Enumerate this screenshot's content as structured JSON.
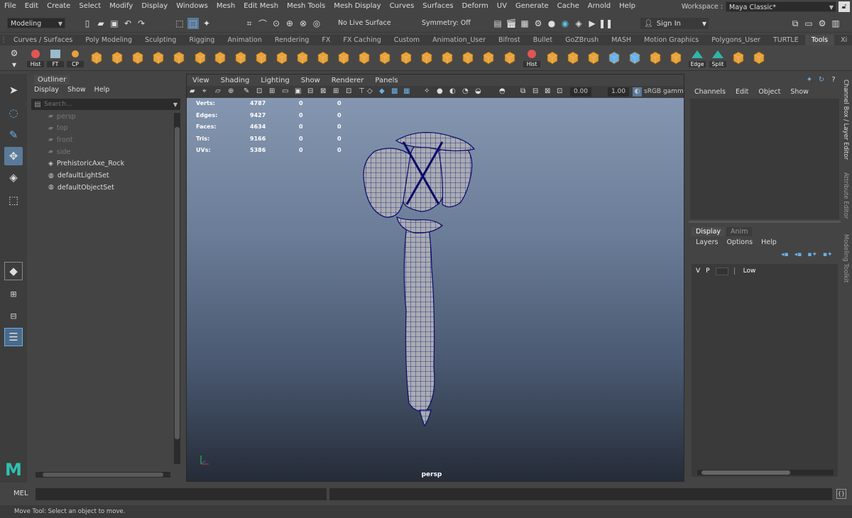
{
  "menus": [
    "File",
    "Edit",
    "Create",
    "Select",
    "Modify",
    "Display",
    "Windows",
    "Mesh",
    "Edit Mesh",
    "Mesh Tools",
    "Mesh Display",
    "Curves",
    "Surfaces",
    "Deform",
    "UV",
    "Generate",
    "Cache",
    "Arnold",
    "Help"
  ],
  "workspace": {
    "label": "Workspace :",
    "value": "Maya Classic*"
  },
  "toolbar": {
    "mode": "Modeling",
    "live_surface": "No Live Surface",
    "symmetry": "Symmetry: Off",
    "sign_in": "Sign In"
  },
  "shelf_tabs": [
    "Curves / Surfaces",
    "Poly Modeling",
    "Sculpting",
    "Rigging",
    "Animation",
    "Rendering",
    "FX",
    "FX Caching",
    "Custom",
    "Animation_User",
    "Bifrost",
    "Bullet",
    "GoZBrush",
    "MASH",
    "Motion Graphics",
    "Polygons_User",
    "TURTLE",
    "Tools",
    "Xi"
  ],
  "shelf_selected": "Tools",
  "shelf_labels": {
    "hist": "Hist",
    "ft": "FT",
    "cp": "CP",
    "hist2": "Hist",
    "edge": "Edge",
    "split": "Split"
  },
  "outliner": {
    "title": "Outliner",
    "menus": [
      "Display",
      "Show",
      "Help"
    ],
    "search_placeholder": "Search...",
    "items": [
      {
        "name": "persp",
        "icon": "camera-icon",
        "dim": true
      },
      {
        "name": "top",
        "icon": "camera-icon",
        "dim": true
      },
      {
        "name": "front",
        "icon": "camera-icon",
        "dim": true
      },
      {
        "name": "side",
        "icon": "camera-icon",
        "dim": true
      },
      {
        "name": "PrehistoricAxe_Rock",
        "icon": "mesh-icon",
        "dim": false
      },
      {
        "name": "defaultLightSet",
        "icon": "set-icon",
        "dim": false
      },
      {
        "name": "defaultObjectSet",
        "icon": "set-icon",
        "dim": false
      }
    ]
  },
  "viewport": {
    "menus": [
      "View",
      "Shading",
      "Lighting",
      "Show",
      "Renderer",
      "Panels"
    ],
    "field1": "0.00",
    "field2": "1.00",
    "colorspace": "sRGB gamma",
    "camera": "persp",
    "hud": [
      {
        "label": "Verts:",
        "v1": "4787",
        "v2": "0",
        "v3": "0"
      },
      {
        "label": "Edges:",
        "v1": "9427",
        "v2": "0",
        "v3": "0"
      },
      {
        "label": "Faces:",
        "v1": "4634",
        "v2": "0",
        "v3": "0"
      },
      {
        "label": "Tris:",
        "v1": "9166",
        "v2": "0",
        "v3": "0"
      },
      {
        "label": "UVs:",
        "v1": "5386",
        "v2": "0",
        "v3": "0"
      }
    ]
  },
  "channel_box": {
    "menus": [
      "Channels",
      "Edit",
      "Object",
      "Show"
    ]
  },
  "layer_editor": {
    "tabs": [
      "Display",
      "Anim"
    ],
    "menus": [
      "Layers",
      "Options",
      "Help"
    ],
    "layer": {
      "v": "V",
      "p": "P",
      "name": "Low"
    }
  },
  "side_tabs": [
    "Channel Box / Layer Editor",
    "Attribute Editor",
    "Modeling Toolkit"
  ],
  "command": {
    "label": "MEL"
  },
  "status": "Move Tool: Select an object to move."
}
